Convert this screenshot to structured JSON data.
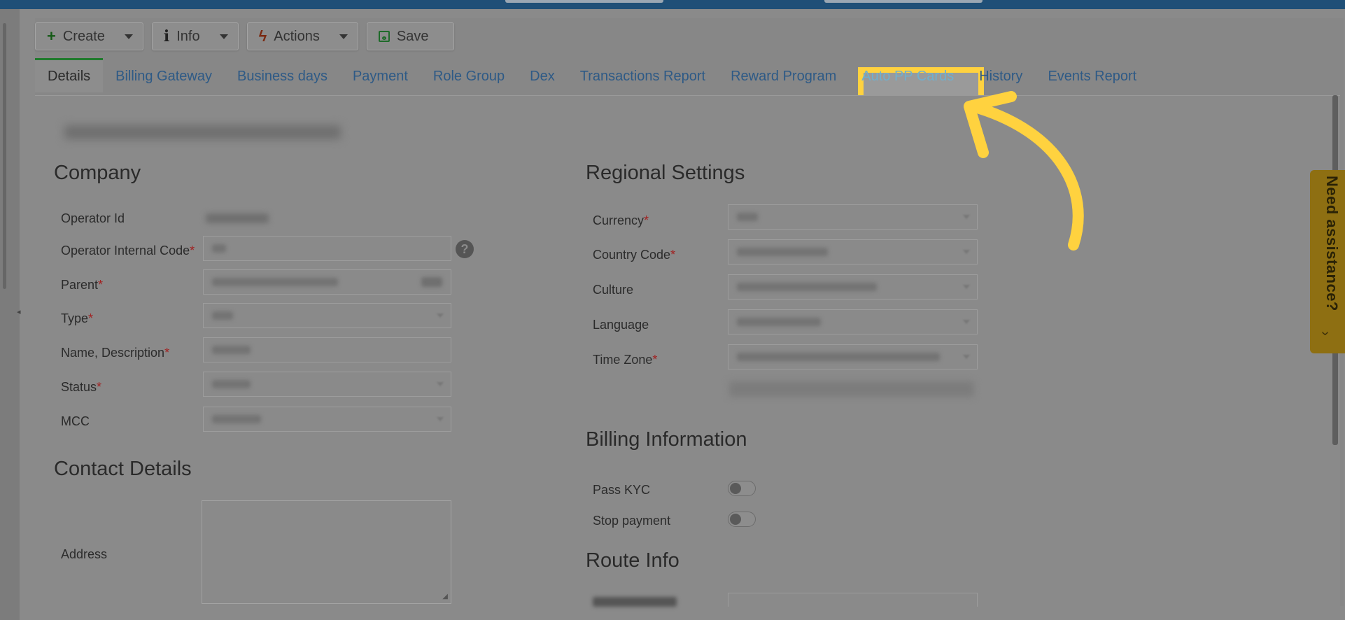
{
  "toolbar": {
    "create_label": "Create",
    "info_label": "Info",
    "actions_label": "Actions",
    "save_label": "Save"
  },
  "tabs": [
    {
      "label": "Details",
      "active": true
    },
    {
      "label": "Billing Gateway"
    },
    {
      "label": "Business days"
    },
    {
      "label": "Payment"
    },
    {
      "label": "Role Group"
    },
    {
      "label": "Dex"
    },
    {
      "label": "Transactions Report"
    },
    {
      "label": "Reward Program"
    },
    {
      "label": "Auto PP Cards",
      "highlighted": true
    },
    {
      "label": "History"
    },
    {
      "label": "Events Report"
    }
  ],
  "company": {
    "title": "Company",
    "labels": {
      "operator_id": "Operator Id",
      "operator_internal_code": "Operator Internal Code",
      "parent": "Parent",
      "type": "Type",
      "name_description": "Name, Description",
      "status": "Status",
      "mcc": "MCC"
    }
  },
  "regional": {
    "title": "Regional Settings",
    "labels": {
      "currency": "Currency",
      "country_code": "Country Code",
      "culture": "Culture",
      "language": "Language",
      "time_zone": "Time Zone"
    }
  },
  "billing": {
    "title": "Billing Information",
    "pass_kyc": "Pass KYC",
    "stop_payment": "Stop payment"
  },
  "contact": {
    "title": "Contact Details",
    "address": "Address"
  },
  "route": {
    "title": "Route Info"
  },
  "required_mark": "*",
  "assist": {
    "label": "Need assistance?"
  },
  "colors": {
    "highlight": "#ffd23f",
    "annotation_arrow": "#ffd23f",
    "link": "#2e5a86"
  }
}
